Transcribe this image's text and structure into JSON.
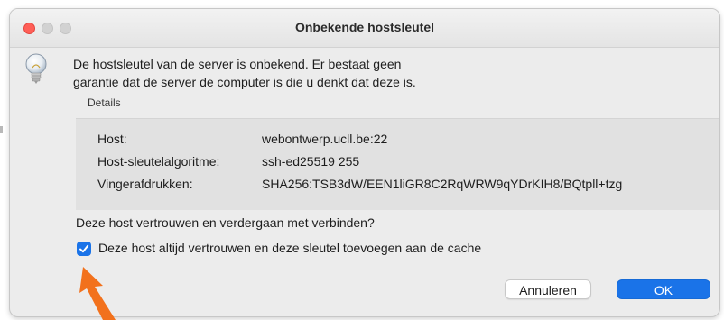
{
  "window": {
    "title": "Onbekende hostsleutel"
  },
  "icons": {
    "window_close": "close-dot",
    "window_minimize": "minimize-dot",
    "window_zoom": "zoom-dot",
    "dialog": "lightbulb-icon",
    "annotation": "orange-arrow-icon",
    "checkbox": "checkmark-icon"
  },
  "message": {
    "line1": "De hostsleutel van de server is onbekend. Er bestaat geen",
    "line2": "garantie dat de server de computer is die u denkt dat deze is."
  },
  "details": {
    "label": "Details",
    "rows": [
      {
        "key": "Host:",
        "value": "webontwerp.ucll.be:22"
      },
      {
        "key": "Host-sleutelalgoritme:",
        "value": "ssh-ed25519 255"
      },
      {
        "key": "Vingerafdrukken:",
        "value": "SHA256:TSB3dW/EEN1liGR8C2RqWRW9qYDrKIH8/BQtpll+tzg"
      }
    ]
  },
  "question": "Deze host vertrouwen en verdergaan met verbinden?",
  "trust_checkbox": {
    "label": "Deze host altijd vertrouwen en deze sleutel toevoegen aan de cache",
    "checked": true
  },
  "buttons": {
    "cancel": "Annuleren",
    "ok": "OK"
  },
  "colors": {
    "accent": "#1a73e8",
    "close_dot": "#ff5f57",
    "annotation_arrow": "#f2711c",
    "dialog_bg": "#ececec"
  }
}
